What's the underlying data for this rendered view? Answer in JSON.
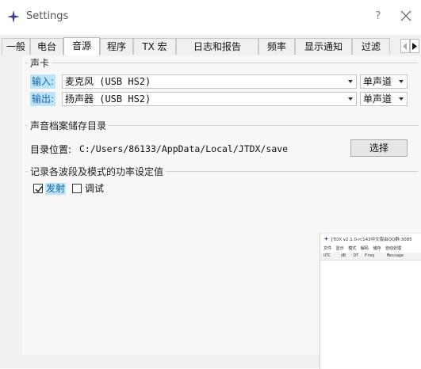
{
  "window": {
    "title": "Settings",
    "help_label": "?"
  },
  "tabs": [
    {
      "label": "一般",
      "active": false
    },
    {
      "label": "电台",
      "active": false
    },
    {
      "label": "音源",
      "active": true
    },
    {
      "label": "程序",
      "active": false
    },
    {
      "label": "TX 宏",
      "active": false
    },
    {
      "label": "日志和报告",
      "active": false
    },
    {
      "label": "频率",
      "active": false
    },
    {
      "label": "显示通知",
      "active": false
    },
    {
      "label": "过滤",
      "active": false
    }
  ],
  "sound_card": {
    "group_title": "声卡",
    "input": {
      "label": "输入:",
      "device": "麦克风 (USB HS2)",
      "channel": "单声道"
    },
    "output": {
      "label": "输出:",
      "device": "扬声器 (USB HS2)",
      "channel": "单声道"
    }
  },
  "save_dir": {
    "group_title": "声音档案储存目录",
    "location_label": "目录位置:",
    "path": "C:/Users/86133/AppData/Local/JTDX/save",
    "select_button": "选择"
  },
  "power": {
    "group_title": "记录各波段及模式的功率设定值",
    "transmit": {
      "label": "发射",
      "checked": true
    },
    "tune": {
      "label": "调试",
      "checked": false
    }
  },
  "jtdx_window": {
    "title": "JTDX v2.1.0-rc143中文版由QQ群:3085",
    "menu": [
      "文件",
      "显示",
      "模式",
      "解码",
      "储存",
      "自动处理"
    ],
    "columns": [
      "UTC",
      "dB",
      "DT",
      "Freq",
      "Message"
    ]
  },
  "colors": {
    "highlight_bg": "#bde4f6",
    "highlight_text": "#1565a8",
    "app_icon": "#3b3b8f"
  }
}
